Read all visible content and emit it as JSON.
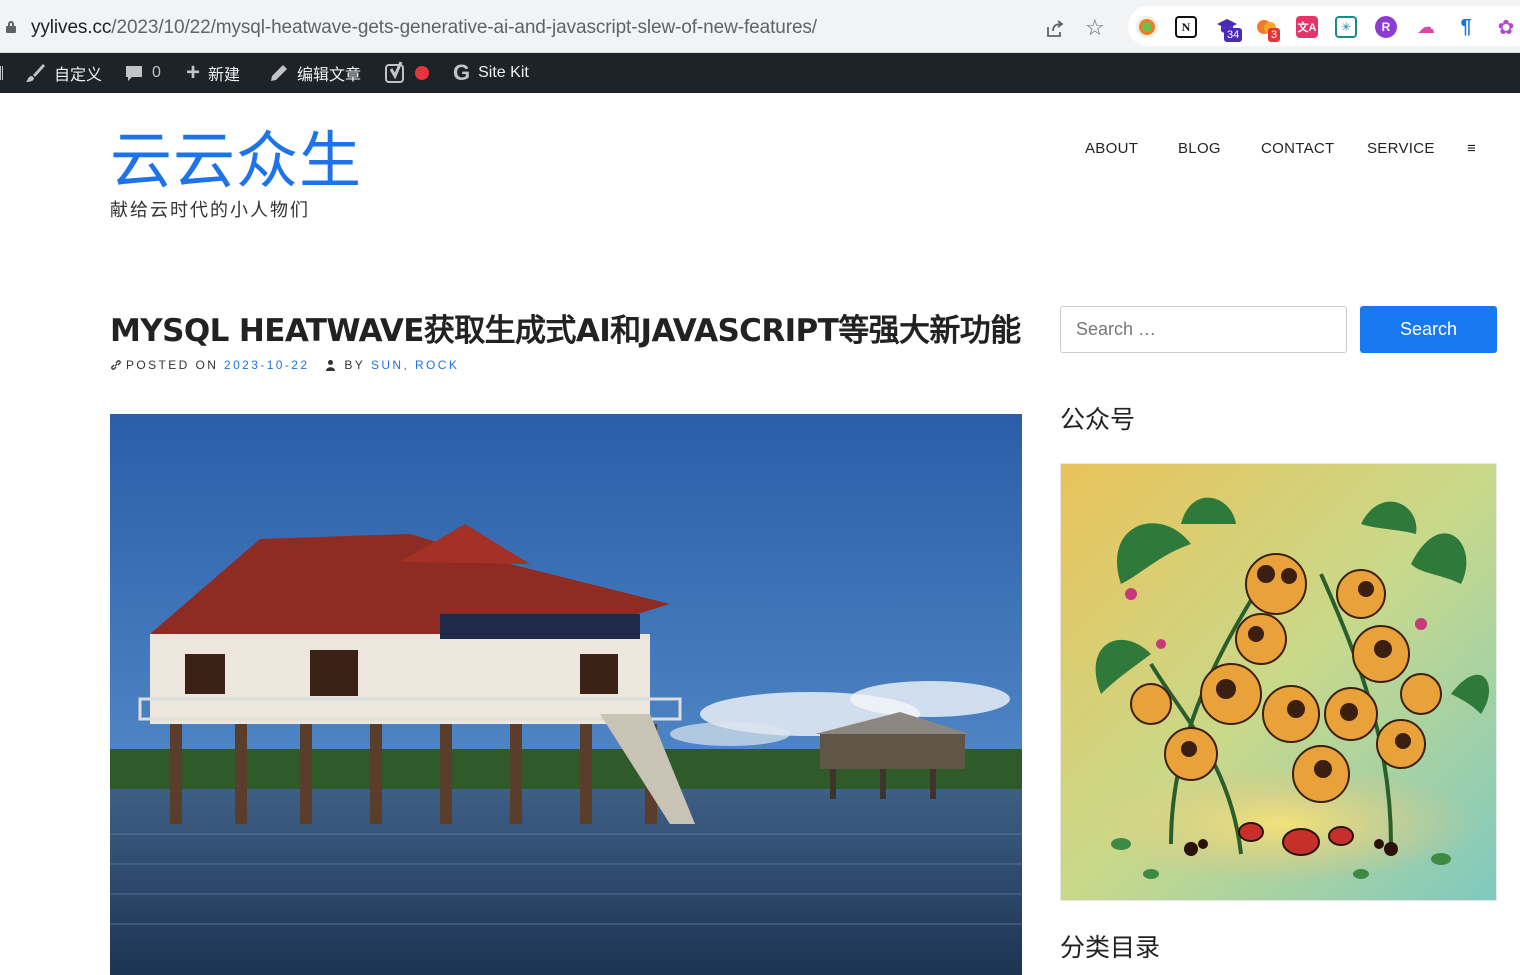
{
  "browser": {
    "url_host": "yylives.cc",
    "url_path": "/2023/10/22/mysql-heatwave-gets-generative-ai-and-javascript-slew-of-new-features/",
    "extension_badges": [
      "34",
      "3"
    ]
  },
  "adminbar": {
    "customize": "自定义",
    "comments_count": "0",
    "new": "新建",
    "edit": "编辑文章",
    "sitekit": "Site Kit"
  },
  "site": {
    "title": "云云众生",
    "description": "献给云时代的小人物们"
  },
  "nav": {
    "items": [
      "ABOUT",
      "BLOG",
      "CONTACT",
      "SERVICE"
    ],
    "menu_toggle": "≡"
  },
  "post": {
    "title": "MYSQL HEATWAVE获取生成式AI和JAVASCRIPT等强大新功能",
    "posted_on_label": "POSTED ON",
    "date": "2023-10-22",
    "by_label": "BY",
    "author": "SUN, ROCK"
  },
  "sidebar": {
    "search_placeholder": "Search …",
    "search_button": "Search",
    "widget1_title": "公众号",
    "widget2_title": "分类目录"
  },
  "colors": {
    "accent": "#1e73e8",
    "adminbar_bg": "#1d2327",
    "search_button_bg": "#1778f2"
  }
}
